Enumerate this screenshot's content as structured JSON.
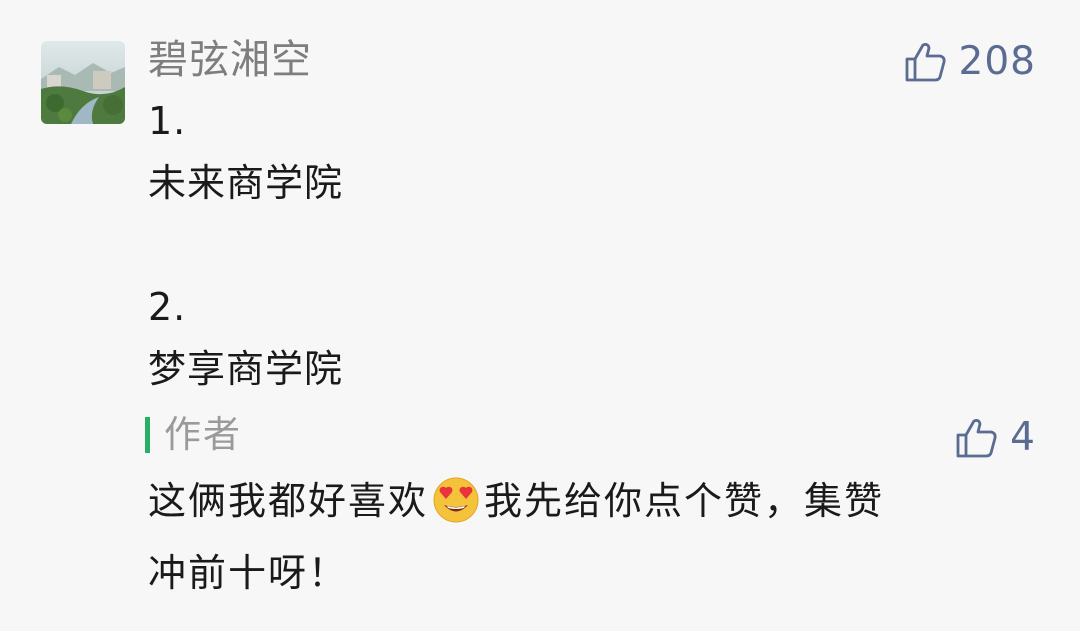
{
  "comment": {
    "username": "碧弦湘空",
    "likes": "208",
    "lines": [
      "1.",
      "未来商学院",
      "",
      "2.",
      "梦享商学院"
    ]
  },
  "reply": {
    "author_label": "作者",
    "likes": "4",
    "text_before_emoji": "这俩我都好喜欢",
    "emoji": "heart-eyes-emoji",
    "text_after_emoji": "我先给你点个赞，集赞",
    "text_line2": "冲前十呀！"
  },
  "colors": {
    "background": "#f7f7f7",
    "username": "#7e7e7e",
    "like": "#5a6c92",
    "author_bar": "#2aae67",
    "body_text": "#1a1a1a"
  }
}
